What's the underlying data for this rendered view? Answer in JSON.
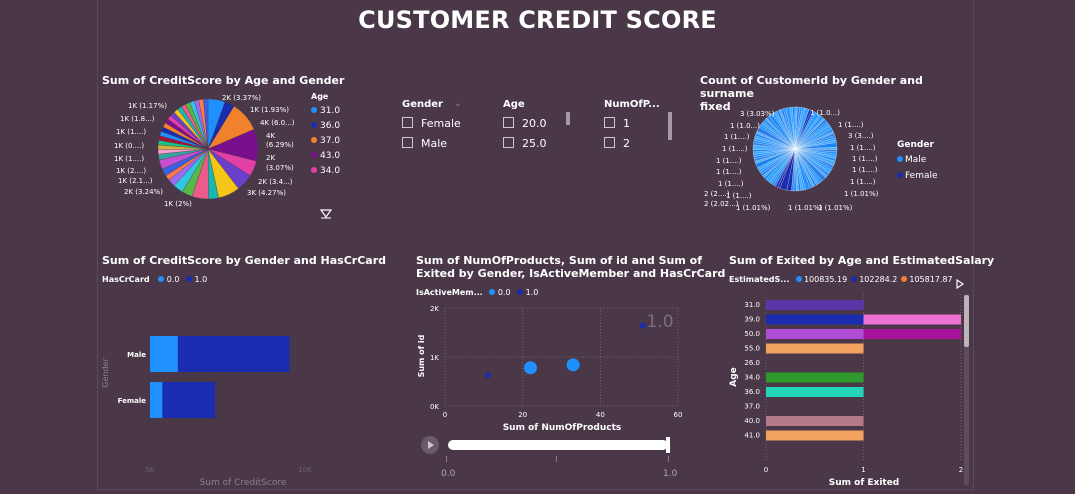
{
  "page_title": "CUSTOMER CREDIT SCORE",
  "colors": {
    "bg": "#4a3848",
    "dark_blue": "#1a2cb0",
    "light_blue": "#1f90ff",
    "pink": "#ee72d4",
    "purple": "#a7159a",
    "orange": "#f2a15f",
    "green": "#2e9a2c",
    "teal": "#22d4b8"
  },
  "pie1": {
    "title": "Sum of CreditScore by Age and Gender",
    "legend_title": "Age",
    "legend": [
      {
        "label": "31.0",
        "color": "#1f90ff"
      },
      {
        "label": "36.0",
        "color": "#1a2cb0"
      },
      {
        "label": "37.0",
        "color": "#f2812e"
      },
      {
        "label": "43.0",
        "color": "#7a0f8e"
      },
      {
        "label": "34.0",
        "color": "#e43fa6"
      }
    ],
    "labels": [
      "2K (3.37%)",
      "1K (1.93%)",
      "4K (6.0...)",
      "4K",
      "(6.29%)",
      "2K",
      "(3.07%)",
      "2K (3.4...)",
      "3K (4.27%)",
      "1K (2%)",
      "2K (3.24%)",
      "1K (2.1...)",
      "1K (2....)",
      "1K (1....)",
      "1K (0....)",
      "1K (1....)",
      "1K (1.8...)",
      "1K (1.17%)"
    ]
  },
  "slicers": {
    "gender": {
      "header": "Gender",
      "items": [
        "Female",
        "Male"
      ]
    },
    "age": {
      "header": "Age",
      "items": [
        "20.0",
        "25.0"
      ]
    },
    "products": {
      "header": "NumOfP...",
      "items": [
        "1",
        "2"
      ]
    }
  },
  "pie2": {
    "title_line1": "Count of CustomerId by Gender and surname",
    "title_line2": "fixed",
    "legend_title": "Gender",
    "legend": [
      {
        "label": "Male",
        "color": "#1f90ff"
      },
      {
        "label": "Female",
        "color": "#1a2cb0"
      }
    ],
    "labels": [
      "3 (3.03%)",
      "1 (1.0...)",
      "1 (1....)",
      "1 (1....)",
      "1 (1....)",
      "1 (1....)",
      "1 (1....)",
      "1 (1....)",
      "2 (2....)",
      "2 (2.02...)",
      "1 (1.01%)",
      "1 (1.01%)",
      "1 (1.01%)",
      "1 (1.0...)",
      "1 (1....)",
      "3 (3....)",
      "1 (1....)",
      "1 (1....)",
      "1 (1....)",
      "1 (1....)",
      "1 (1.01%)"
    ]
  },
  "bar1": {
    "title": "Sum of CreditScore by Gender and HasCrCard",
    "legend_title": "HasCrCard",
    "legend": [
      {
        "label": "0.0",
        "color": "#1f90ff"
      },
      {
        "label": "1.0",
        "color": "#1a2cb0"
      }
    ],
    "ylabel": "Gender",
    "xlabel": "Sum of CreditScore",
    "xticks": [
      "5K",
      "10K"
    ]
  },
  "scatter": {
    "title_line1": "Sum of NumOfProducts, Sum of id and Sum of",
    "title_line2": "Exited by Gender, IsActiveMember and HasCrCard",
    "legend_title": "IsActiveMem...",
    "legend": [
      {
        "label": "0.0",
        "color": "#1f90ff"
      },
      {
        "label": "1.0",
        "color": "#1a2cb0"
      }
    ],
    "ylabel": "Sum of id",
    "xlabel": "Sum of NumOfProducts",
    "yticks": [
      "2K",
      "1K",
      "0K"
    ],
    "xticks": [
      "0",
      "20",
      "40",
      "60"
    ],
    "watermark": "1.0",
    "play_ticks": [
      "0.0",
      "1.0"
    ]
  },
  "bar2": {
    "title": "Sum of Exited by Age and EstimatedSalary",
    "legend_title": "EstimatedS...",
    "legend": [
      {
        "label": "100835.19",
        "color": "#1f90ff"
      },
      {
        "label": "102284.2",
        "color": "#1a2cb0"
      },
      {
        "label": "105817.87",
        "color": "#f2812e"
      }
    ],
    "ylabel": "Age",
    "xlabel": "Sum of Exited",
    "xticks": [
      "0",
      "1",
      "2"
    ]
  },
  "chart_data": [
    {
      "type": "pie",
      "title": "Sum of CreditScore by Age and Gender",
      "legend_title": "Age",
      "series": [
        {
          "name": "31.0",
          "value": 3.37
        },
        {
          "name": "36.0",
          "value": 1.93
        },
        {
          "name": "37.0",
          "value": 6.0
        },
        {
          "name": "43.0",
          "value": 6.29
        },
        {
          "name": "34.0",
          "value": 3.07
        },
        {
          "name": "",
          "value": 3.4
        },
        {
          "name": "",
          "value": 4.27
        },
        {
          "name": "",
          "value": 2.0
        },
        {
          "name": "",
          "value": 3.24
        },
        {
          "name": "",
          "value": 2.1
        },
        {
          "name": "",
          "value": 2.0
        },
        {
          "name": "",
          "value": 1.5
        },
        {
          "name": "",
          "value": 1.0
        },
        {
          "name": "",
          "value": 1.5
        },
        {
          "name": "",
          "value": 1.8
        },
        {
          "name": "",
          "value": 1.17
        }
      ]
    },
    {
      "type": "pie",
      "title": "Count of CustomerId by Gender and surname fixed",
      "legend_title": "Gender",
      "series_count": 99
    },
    {
      "type": "bar",
      "orientation": "horizontal",
      "stacked": true,
      "title": "Sum of CreditScore by Gender and HasCrCard",
      "categories": [
        "Male",
        "Female"
      ],
      "series": [
        {
          "name": "0.0",
          "values": [
            1800,
            800
          ]
        },
        {
          "name": "1.0",
          "values": [
            7200,
            3400
          ]
        }
      ],
      "xlabel": "Sum of CreditScore",
      "ylabel": "Gender",
      "xlim": [
        0,
        10000
      ]
    },
    {
      "type": "scatter",
      "title": "Sum of NumOfProducts, Sum of id and Sum of Exited by Gender, IsActiveMember and HasCrCard",
      "xlabel": "Sum of NumOfProducts",
      "ylabel": "Sum of id",
      "xlim": [
        0,
        60
      ],
      "ylim": [
        0,
        2000
      ],
      "series": [
        {
          "name": "0.0",
          "points": [
            {
              "x": 22,
              "y": 780,
              "size": 2
            },
            {
              "x": 33,
              "y": 840,
              "size": 2
            }
          ]
        },
        {
          "name": "1.0",
          "points": [
            {
              "x": 11,
              "y": 630,
              "size": 1
            },
            {
              "x": 51,
              "y": 1640,
              "size": 1
            }
          ]
        }
      ]
    },
    {
      "type": "bar",
      "orientation": "horizontal",
      "title": "Sum of Exited by Age and EstimatedSalary",
      "categories": [
        "31.0",
        "39.0",
        "50.0",
        "55.0",
        "26.0",
        "34.0",
        "36.0",
        "37.0",
        "40.0",
        "41.0"
      ],
      "bars": [
        {
          "segments": [
            {
              "value": 1,
              "color": "#5b35a8"
            }
          ]
        },
        {
          "segments": [
            {
              "value": 1,
              "color": "#1a2cb0"
            },
            {
              "value": 1,
              "color": "#ee72d4"
            }
          ]
        },
        {
          "segments": [
            {
              "value": 1,
              "color": "#b04dd6"
            },
            {
              "value": 1,
              "color": "#a7159a"
            }
          ]
        },
        {
          "segments": [
            {
              "value": 1,
              "color": "#f2a15f"
            }
          ]
        },
        {
          "segments": []
        },
        {
          "segments": [
            {
              "value": 1,
              "color": "#2e9a2c"
            }
          ]
        },
        {
          "segments": [
            {
              "value": 1,
              "color": "#22d4b8"
            }
          ]
        },
        {
          "segments": []
        },
        {
          "segments": [
            {
              "value": 1,
              "color": "#b57a8a"
            }
          ]
        },
        {
          "segments": [
            {
              "value": 1,
              "color": "#f2a15f"
            }
          ]
        }
      ],
      "xlabel": "Sum of Exited",
      "ylabel": "Age",
      "xlim": [
        0,
        2
      ]
    }
  ]
}
